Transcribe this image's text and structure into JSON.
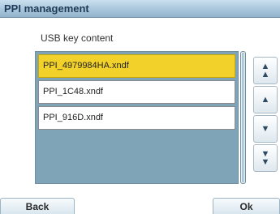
{
  "window": {
    "title": "PPI management"
  },
  "content": {
    "label": "USB key content"
  },
  "list": {
    "items": [
      {
        "name": "PPI_4979984HA.xndf",
        "selected": true
      },
      {
        "name": "PPI_1C48.xndf",
        "selected": false
      },
      {
        "name": "PPI_916D.xndf",
        "selected": false
      }
    ]
  },
  "nav": {
    "first_icon": "double-chevron-up",
    "up_icon": "chevron-up",
    "down_icon": "chevron-down",
    "last_icon": "double-chevron-down"
  },
  "footer": {
    "back_label": "Back",
    "ok_label": "Ok"
  },
  "colors": {
    "selected": "#f2d12a",
    "list_background": "#7fa4b7",
    "title_text": "#1e3a56"
  }
}
